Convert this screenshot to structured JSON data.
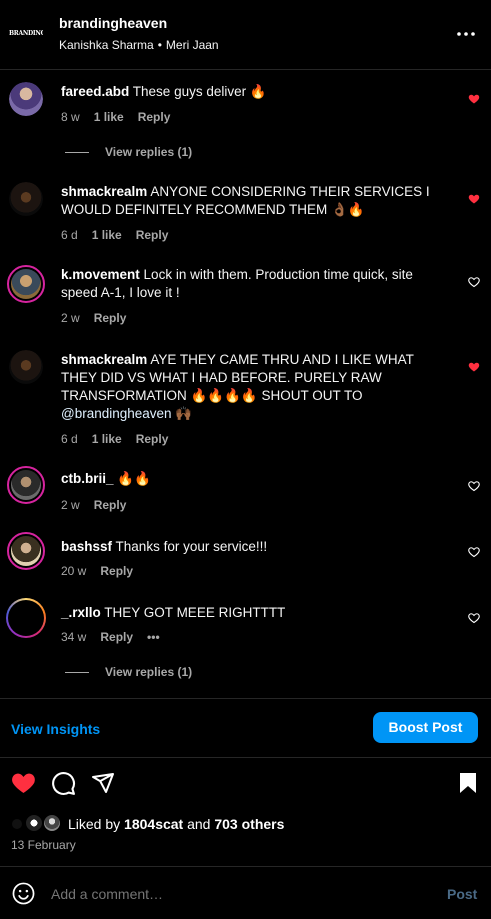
{
  "header": {
    "logo_text": "BRANDINGHEAVEN",
    "account": "brandingheaven",
    "subtitle_user": "Kanishka Sharma",
    "subtitle_dot": "•",
    "subtitle_audio": "Meri Jaan"
  },
  "comments": [
    {
      "user": "fareed.abd",
      "text": "These guys deliver 🔥",
      "time": "8 w",
      "likes": "1 like",
      "reply": "Reply",
      "liked": true,
      "view_replies": "View replies (1)"
    },
    {
      "user": "shmackrealm",
      "text": "ANYONE CONSIDERING THEIR SERVICES I WOULD DEFINITELY RECOMMEND THEM 👌🏾🔥",
      "time": "6 d",
      "likes": "1 like",
      "reply": "Reply",
      "liked": true
    },
    {
      "user": "k.movement",
      "text": "Lock in with them. Production time quick, site speed A-1, I love it !",
      "time": "2 w",
      "reply": "Reply",
      "liked": false
    },
    {
      "user": "shmackrealm",
      "text": "AYE THEY CAME THRU AND I LIKE WHAT THEY DID VS WHAT I HAD BEFORE. PURELY RAW TRANSFORMATION 🔥🔥🔥🔥 SHOUT OUT TO ",
      "mention": "@brandingheaven",
      "after_mention": " 🙌🏾",
      "time": "6 d",
      "likes": "1 like",
      "reply": "Reply",
      "liked": true
    },
    {
      "user": "ctb.brii_",
      "text": "🔥🔥",
      "time": "2 w",
      "reply": "Reply",
      "liked": false
    },
    {
      "user": "bashssf",
      "text": "Thanks for your service!!!",
      "time": "20 w",
      "reply": "Reply",
      "liked": false
    },
    {
      "user": "_.rxllo",
      "text": "THEY GOT MEEE RIGHTTTT",
      "time": "34 w",
      "reply": "Reply",
      "more": "•••",
      "liked": false,
      "view_replies": "View replies (1)"
    }
  ],
  "actions": {
    "view_insights": "View Insights",
    "boost_post": "Boost Post"
  },
  "likes": {
    "prefix": "Liked by",
    "user": "1804scat",
    "middle": "and",
    "others": "703 others"
  },
  "date": "13 February",
  "comment_box": {
    "placeholder": "Add a comment…",
    "post": "Post"
  },
  "colors": {
    "accent": "#0095f6",
    "like_red": "#ff3040",
    "muted": "#a8a8a8"
  }
}
